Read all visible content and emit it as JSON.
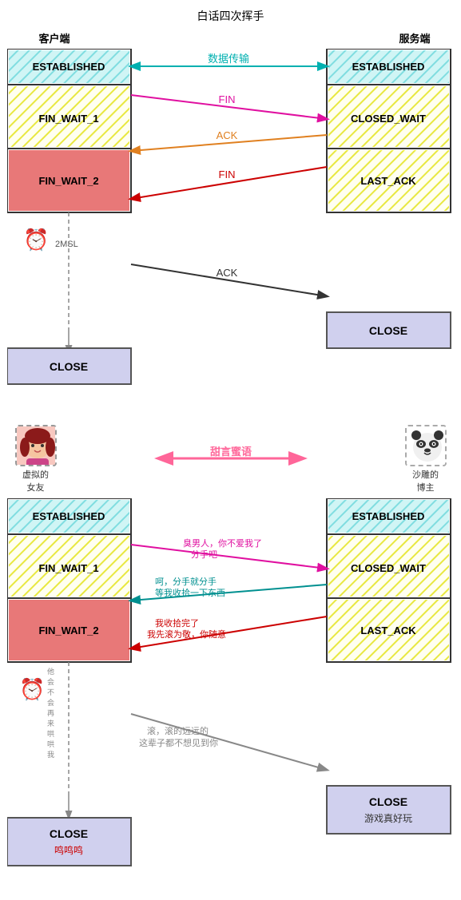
{
  "top": {
    "title": "白话四次挥手",
    "client_label": "客户端",
    "server_label": "服务端",
    "states_left": [
      "ESTABLISHED",
      "FIN_WAIT_1",
      "FIN_WAIT_2",
      "CLOSE"
    ],
    "states_right": [
      "ESTABLISHED",
      "CLOSED_WAIT",
      "LAST_ACK",
      "CLOSE"
    ],
    "timer_label": "2MSL",
    "data_transfer_label": "数据传输",
    "fin1_label": "FIN",
    "ack1_label": "ACK",
    "fin2_label": "FIN",
    "ack2_label": "ACK"
  },
  "bottom": {
    "avatar_left_label": "虚拟的\n女友",
    "avatar_right_label": "沙雕的\n博主",
    "sweet_talk_label": "甜言蜜语",
    "states_left": [
      "ESTABLISHED",
      "FIN_WAIT_1",
      "FIN_WAIT_2",
      "CLOSE\n鸣鸣鸣"
    ],
    "states_right": [
      "ESTABLISHED",
      "CLOSED_WAIT",
      "LAST_ACK",
      "CLOSE\n游戏真好玩"
    ],
    "msg1": "臭男人，你不爱我了\n分手吧",
    "msg2": "呵，分手就分手\n等我收拾一下东西",
    "msg3": "我收拾完了\n我先滚为敬，你随意",
    "msg4": "滚，滚的远远的\n这辈子都不想见到你",
    "timer_note": "他\n会\n不\n会\n再\n来\n哄\n哄\n我"
  }
}
